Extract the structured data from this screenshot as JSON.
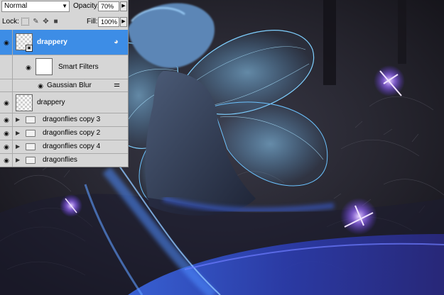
{
  "layers_panel": {
    "blend_mode": "Normal",
    "opacity_label": "Opacity:",
    "opacity_value": "70%",
    "lock_label": "Lock:",
    "fill_label": "Fill:",
    "fill_value": "100%",
    "layers": [
      {
        "name": "drappery",
        "selected": true,
        "type": "smart-object"
      },
      {
        "name": "Smart Filters",
        "type": "smart-filters"
      },
      {
        "name": "Gaussian Blur",
        "type": "filter"
      },
      {
        "name": "drappery",
        "type": "layer"
      },
      {
        "name": "dragonflies copy 3",
        "type": "group"
      },
      {
        "name": "dragonflies copy 2",
        "type": "group"
      },
      {
        "name": "dragonflies copy 4",
        "type": "group"
      },
      {
        "name": "dragonflies",
        "type": "group"
      }
    ]
  },
  "colors": {
    "selection": "#3d8de6",
    "panel_bg": "#d6d6d6",
    "glow_blue": "#5fb8ff",
    "glow_purple": "#9a6bff"
  },
  "icons": [
    "eye-icon",
    "lock-transparent-icon",
    "lock-paint-icon",
    "lock-move-icon",
    "lock-all-icon",
    "folder-icon",
    "expand-triangle-icon",
    "filter-options-icon",
    "smart-object-badge-icon"
  ]
}
